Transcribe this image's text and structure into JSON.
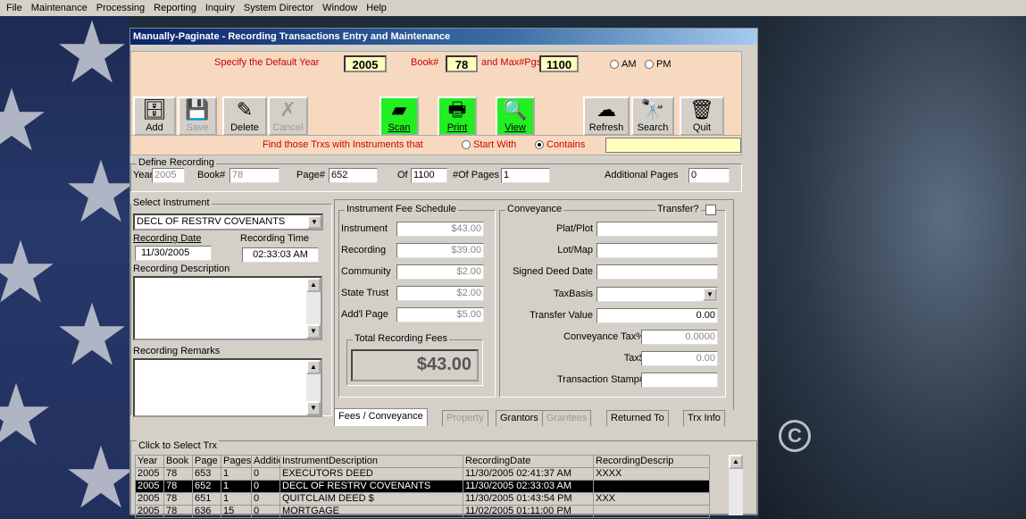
{
  "menu": [
    "File",
    "Maintenance",
    "Processing",
    "Reporting",
    "Inquiry",
    "System Director",
    "Window",
    "Help"
  ],
  "window": {
    "title": "Manually-Paginate - Recording Transactions Entry and Maintenance"
  },
  "top": {
    "year_label": "Specify the Default Year",
    "year": "2005",
    "book_label": "Book#",
    "book": "78",
    "maxpgs_label": "and Max#Pgs",
    "maxpgs": "1100",
    "am": "AM",
    "pm": "PM"
  },
  "toolbar": [
    {
      "label": "Add New",
      "icon": "cabinet-icon",
      "state": "normal"
    },
    {
      "label": "Save",
      "icon": "disk-icon",
      "state": "disabled"
    },
    {
      "label": "Delete",
      "icon": "eraser-icon",
      "state": "normal"
    },
    {
      "label": "Cancel",
      "icon": "cancel-icon",
      "state": "disabled"
    },
    {
      "label": "Scan",
      "icon": "scanner-icon",
      "state": "green"
    },
    {
      "label": "Print",
      "icon": "printer-icon",
      "state": "green"
    },
    {
      "label": "View",
      "icon": "view-icon",
      "state": "green"
    },
    {
      "label": "Refresh",
      "icon": "refresh-icon",
      "state": "normal"
    },
    {
      "label": "Search",
      "icon": "binoculars-icon",
      "state": "normal"
    },
    {
      "label": "Quit",
      "icon": "trash-icon",
      "state": "normal"
    }
  ],
  "find": {
    "label": "Find those Trxs with Instruments that",
    "start_with": "Start With",
    "contains": "Contains",
    "value": ""
  },
  "define": {
    "title": "Define Recording",
    "year_label": "Year",
    "year": "2005",
    "book_label": "Book#",
    "book": "78",
    "page_label": "Page#",
    "page": "652",
    "of_label": "Of",
    "of": "1100",
    "pages_label": "#Of Pages",
    "pages": "1",
    "addl_label": "Additional Pages",
    "addl": "0"
  },
  "instrument": {
    "title": "Select Instrument",
    "selected": "DECL OF RESTRV COVENANTS",
    "date_label": "Recording Date",
    "date": "11/30/2005",
    "time_label": "Recording Time",
    "time": "02:33:03 AM",
    "desc_label": "Recording Description",
    "remarks_label": "Recording Remarks"
  },
  "fees": {
    "title": "Instrument Fee Schedule",
    "rows": [
      {
        "label": "Instrument",
        "value": "$43.00"
      },
      {
        "label": "Recording",
        "value": "$39.00"
      },
      {
        "label": "Community",
        "value": "$2.00"
      },
      {
        "label": "State Trust",
        "value": "$2.00"
      },
      {
        "label": "Add'l Page",
        "value": "$5.00"
      }
    ],
    "total_label": "Total Recording Fees",
    "total": "$43.00"
  },
  "conveyance": {
    "title": "Conveyance",
    "transfer_label": "Transfer?",
    "plat_label": "Plat/Plot",
    "lot_label": "Lot/Map",
    "signed_label": "Signed Deed Date",
    "taxbasis_label": "TaxBasis",
    "transfer_value_label": "Transfer Value",
    "transfer_value": "0.00",
    "conv_tax_label": "Conveyance Tax%",
    "conv_tax": "0.0000",
    "tax_label": "Tax$",
    "tax": "0.00",
    "stamp_label": "Transaction Stamp#"
  },
  "tabs": [
    {
      "label": "Fees / Conveyance",
      "state": "active"
    },
    {
      "label": "Property",
      "state": "disabled"
    },
    {
      "label": "Grantors",
      "state": "normal"
    },
    {
      "label": "Grantees",
      "state": "disabled"
    },
    {
      "label": "Returned To",
      "state": "normal"
    },
    {
      "label": "Trx Info",
      "state": "normal"
    }
  ],
  "grid": {
    "title": "Click to Select Trx",
    "columns": [
      "Year",
      "Book",
      "Page",
      "Pages",
      "Additio",
      "InstrumentDescription",
      "RecordingDate",
      "RecordingDescrip"
    ],
    "rows": [
      [
        "2005",
        "78",
        "653",
        "1",
        "0",
        "EXECUTORS DEED",
        "11/30/2005 02:41:37 AM",
        "XXXX"
      ],
      [
        "2005",
        "78",
        "652",
        "1",
        "0",
        "DECL OF RESTRV COVENANTS",
        "11/30/2005 02:33:03 AM",
        ""
      ],
      [
        "2005",
        "78",
        "651",
        "1",
        "0",
        "QUITCLAIM DEED $",
        "11/30/2005 01:43:54 PM",
        "XXX"
      ],
      [
        "2005",
        "78",
        "636",
        "15",
        "0",
        "MORTGAGE",
        "11/02/2005 01:11:00 PM",
        ""
      ]
    ],
    "selected_index": 1
  }
}
